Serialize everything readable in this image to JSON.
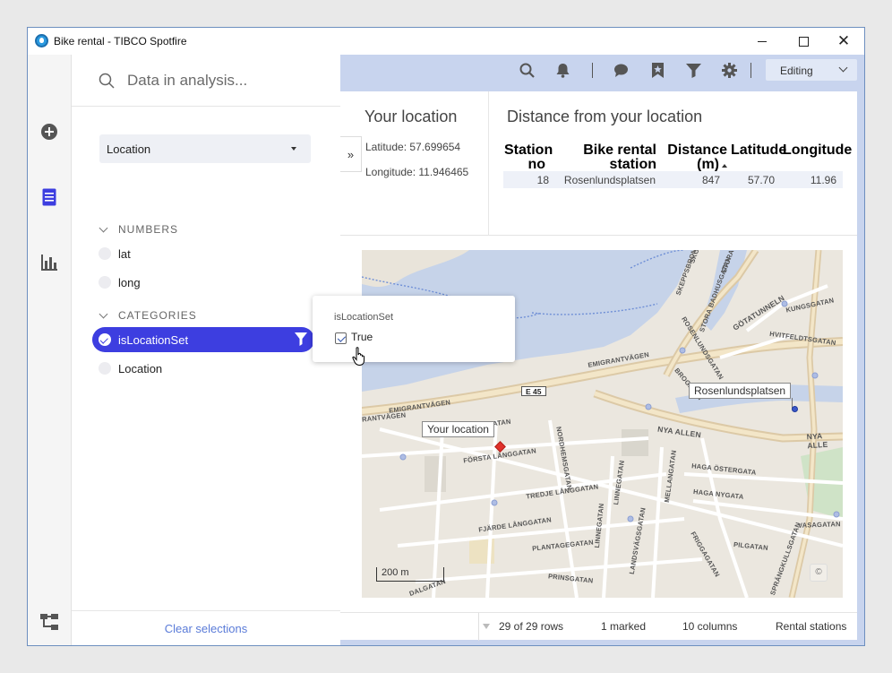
{
  "window": {
    "title": "Bike rental - TIBCO Spotfire"
  },
  "sidebar": {
    "icons": [
      "add-icon",
      "data-panel-icon",
      "visualization-icon",
      "data-canvas-icon"
    ]
  },
  "data_panel": {
    "search_placeholder": "Data in analysis...",
    "table_select": "Location",
    "numbers_header": "NUMBERS",
    "numbers": [
      "lat",
      "long"
    ],
    "categories_header": "CATEGORIES",
    "categories": [
      "isLocationSet",
      "Location"
    ],
    "clear_label": "Clear selections"
  },
  "filter_popup": {
    "title": "isLocationSet",
    "option_label": "True",
    "option_checked": true
  },
  "toolbar": {
    "mode_label": "Editing"
  },
  "your_location": {
    "title": "Your location",
    "latitude": "Latitude: 57.699654",
    "longitude": "Longitude: 11.946465",
    "expand_label": "»"
  },
  "distance_table": {
    "title": "Distance from your location",
    "headers": [
      [
        "Station",
        "no"
      ],
      [
        "Bike rental station",
        "name"
      ],
      [
        "Distance",
        "(m)"
      ],
      [
        "Latitude"
      ],
      [
        "Longitude"
      ]
    ],
    "rows": [
      [
        "18",
        "Rosenlundsplatsen",
        "847",
        "57.70",
        "11.96"
      ]
    ]
  },
  "map": {
    "road_sign": "E 45",
    "your_location_label": "Your location",
    "station_label": "Rosenlundsplatsen",
    "scale_label": "200 m",
    "copyright": "©",
    "streets": [
      "SKEPPSBRON",
      "STORA BADHUSGATAN",
      "GÖTATUNNELN",
      "KUNGSGATAN",
      "HVITFELDTSGATAN",
      "ROSENLUNDSGATAN",
      "EMIGRANTVÄGEN",
      "EMIGRANTVÄGEN",
      "RANTVÄGEN",
      "NYA ALLEN",
      "NYA ALLE",
      "FÖRSTA LÅNGGATAN",
      "NORDHEMSGATAN",
      "LINNEGATAN",
      "MELLANGATAN",
      "HAGA ÖSTERGATA",
      "HAGA NYGATA",
      "TREDJE LÅNGGATAN",
      "FJÄRDE LÅNGGATAN",
      "PLANTAGEGATAN",
      "LANDSVÄGSGATAN",
      "LINNEGATAN",
      "PRINSGATAN",
      "FRIGGAGATAN",
      "PILGATAN",
      "SPRÄNGKULLSGATAN",
      "VASAGATAN",
      "SKO",
      "STORA",
      "ATAN",
      "DALGATAN",
      "BROGATAN"
    ]
  },
  "status_bar": {
    "rows": "29 of 29 rows",
    "marked": "1 marked",
    "columns": "10 columns",
    "table": "Rental stations"
  },
  "colors": {
    "accent": "#3d3ee0",
    "toolbar_bg": "#c8d4ee",
    "link": "#5a7bd8",
    "marker_red": "#e0312b",
    "marker_blue": "#3b57c8"
  }
}
